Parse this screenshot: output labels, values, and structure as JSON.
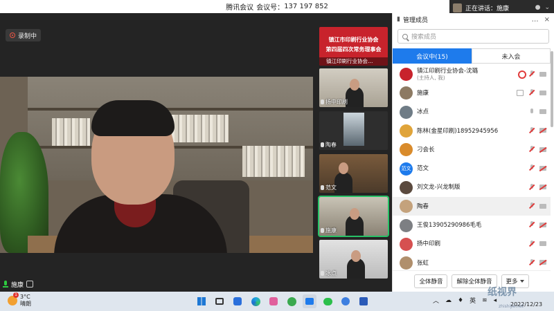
{
  "titlebar": {
    "app": "腾讯会议",
    "meeting_id_label": "会议号：",
    "meeting_id": "137 197 852"
  },
  "recording": {
    "label": "录制中"
  },
  "main_speaker": {
    "name": "施康"
  },
  "speaking_now": {
    "label": "正在讲话：",
    "name": "施康"
  },
  "thumbnails": [
    {
      "label": "镇江印刷行业协会…",
      "banner_line1": "镇江市印刷行业协会",
      "banner_line2": "第四届四次常务理事会"
    },
    {
      "label": "扬中印刷"
    },
    {
      "label": "陶春"
    },
    {
      "label": "范文"
    },
    {
      "label": "施康"
    },
    {
      "label": "冰点"
    }
  ],
  "panel": {
    "title": "管理成员",
    "search_placeholder": "搜索成员",
    "tab_in_meeting": "会议中(15)",
    "tab_not_joined": "未入会",
    "members": [
      {
        "name": "镇江印刷行业协会-沈璐",
        "sub": "(主持人, 我)",
        "avatar_color": "#c8232c",
        "avatar_text": ""
      },
      {
        "name": "施康",
        "sub": "",
        "avatar_color": "#8d7a63",
        "avatar_text": ""
      },
      {
        "name": "冰点",
        "sub": "",
        "avatar_color": "#6f7c86",
        "avatar_text": ""
      },
      {
        "name": "陈林(金星印刷)18952945956",
        "sub": "",
        "avatar_color": "#e0a43a",
        "avatar_text": ""
      },
      {
        "name": "刁会长",
        "sub": "",
        "avatar_color": "#d98b2b",
        "avatar_text": ""
      },
      {
        "name": "范文",
        "sub": "",
        "avatar_color": "#1e7bec",
        "avatar_text": "范文"
      },
      {
        "name": "刘文龙-兴龙制版",
        "sub": "",
        "avatar_color": "#5b4a3e",
        "avatar_text": ""
      },
      {
        "name": "陶春",
        "sub": "",
        "avatar_color": "#c4a27c",
        "avatar_text": ""
      },
      {
        "name": "王俊13905290986毛毛",
        "sub": "",
        "avatar_color": "#7d7f83",
        "avatar_text": ""
      },
      {
        "name": "扬中印刷",
        "sub": "",
        "avatar_color": "#d65050",
        "avatar_text": ""
      },
      {
        "name": "张虹",
        "sub": "",
        "avatar_color": "#b08f6c",
        "avatar_text": ""
      }
    ],
    "mute_all": "全体静音",
    "unmute_all": "解除全体静音",
    "more": "更多"
  },
  "taskbar": {
    "temperature": "3°C",
    "weather": "晴朗",
    "weather_badge": "1",
    "input_method": "英",
    "clock_date": "2022/12/23",
    "watermark": "纸视界",
    "watermark_url": "zhishijie.net"
  },
  "colors": {
    "accent": "#1e7bec",
    "active_outline": "#27c267",
    "record": "#e03b3b"
  }
}
